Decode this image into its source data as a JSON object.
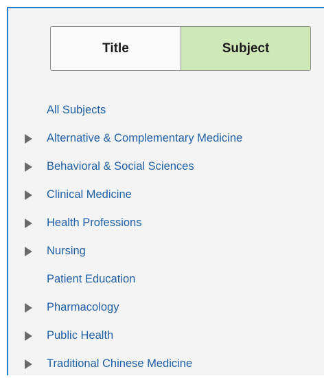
{
  "toggle": {
    "title_label": "Title",
    "subject_label": "Subject",
    "active": "Subject"
  },
  "subjects": [
    {
      "label": "All Subjects",
      "expandable": false
    },
    {
      "label": "Alternative & Complementary Medicine",
      "expandable": true
    },
    {
      "label": "Behavioral & Social Sciences",
      "expandable": true
    },
    {
      "label": "Clinical Medicine",
      "expandable": true
    },
    {
      "label": "Health Professions",
      "expandable": true
    },
    {
      "label": "Nursing",
      "expandable": true
    },
    {
      "label": "Patient Education",
      "expandable": false
    },
    {
      "label": "Pharmacology",
      "expandable": true
    },
    {
      "label": "Public Health",
      "expandable": true
    },
    {
      "label": "Traditional Chinese Medicine",
      "expandable": true
    }
  ],
  "colors": {
    "panel_border": "#1b7ed6",
    "active_tab": "#cfe8b8",
    "link": "#1e5fa5",
    "expand_arrow": "#6a6a6a"
  }
}
